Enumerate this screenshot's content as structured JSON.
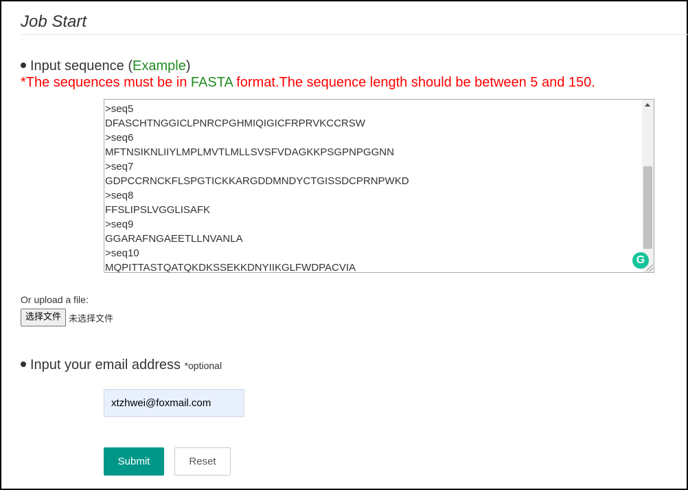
{
  "page": {
    "title": "Job Start"
  },
  "sequence_section": {
    "heading_prefix": "Input sequence (",
    "example_link": "Example",
    "heading_suffix": ")",
    "warning_prefix": "*The sequences must be in ",
    "fasta_link": "FASTA",
    "warning_suffix": " format.The sequence length should be between 5 and 150.",
    "textarea_value": ">seq5\nDFASCHTNGGICLPNRCPGHMIQIGICFRPRVKCCRSW\n>seq6\nMFTNSIKNLIIYLMPLMVTLMLLSVSFVDAGKKPSGPNPGGNN\n>seq7\nGDPCCRNCKFLSPGTICKKARGDDMNDYCTGISSDCPRNPWKD\n>seq8\nFFSLIPSLVGGLISAFK\n>seq9\nGGARAFNGAEETLLNVANLA\n>seq10\nMQPITTASTQATQKDKSSEKKDNYIIKGLFWDPACVIA",
    "grammarly_badge": "G"
  },
  "upload": {
    "label": "Or upload a file:",
    "button_label": "选择文件",
    "status_text": "未选择文件"
  },
  "email_section": {
    "heading": "Input your email address ",
    "optional_label": "*optional",
    "email_value": "xtzhwei@foxmail.com"
  },
  "actions": {
    "submit_label": "Submit",
    "reset_label": "Reset"
  },
  "colors": {
    "warning": "#ff0000",
    "link_green": "#228b22",
    "submit_bg": "#009688",
    "email_bg": "#e8f0fe"
  },
  "icons": {
    "grammarly": "grammarly-icon",
    "scroll_up": "scroll-up-arrow-icon",
    "resize": "resize-grip-icon"
  }
}
